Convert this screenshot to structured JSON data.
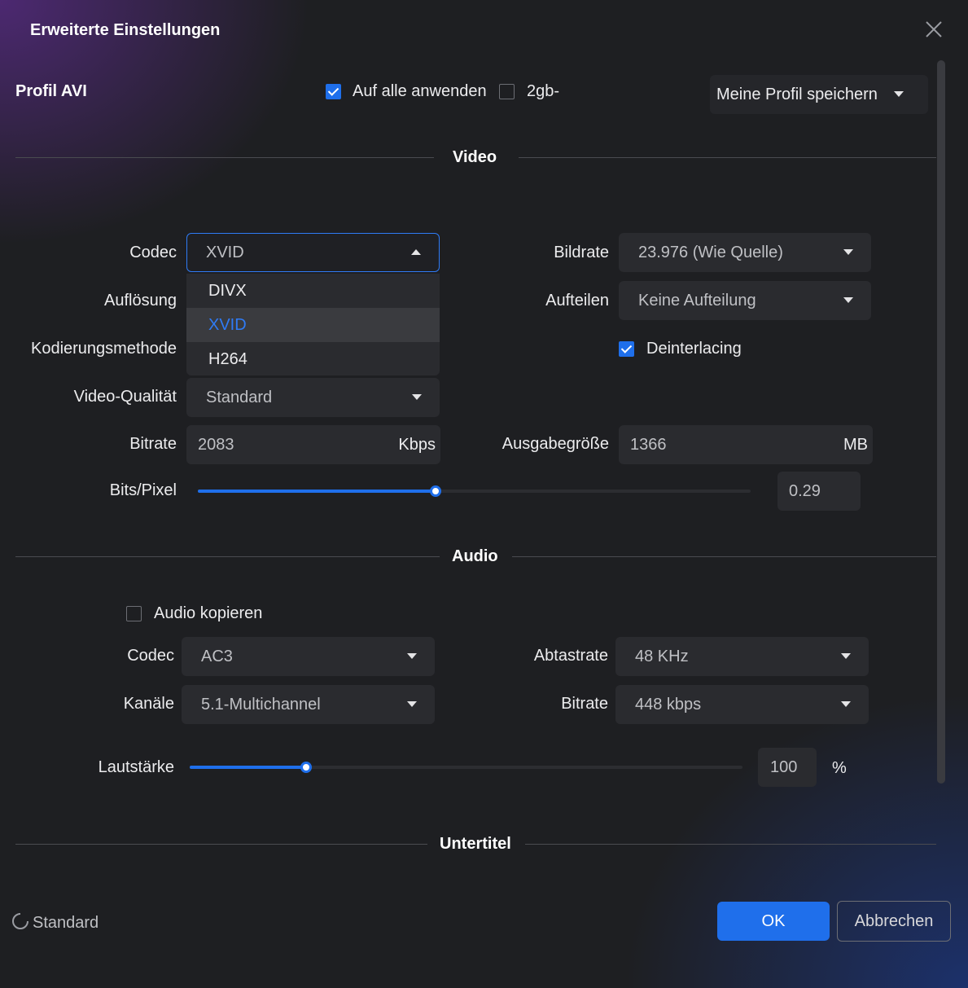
{
  "dialog": {
    "title": "Erweiterte Einstellungen"
  },
  "profile": {
    "label": "Profil  AVI",
    "apply_all": {
      "label": "Auf alle anwenden",
      "checked": true
    },
    "split_2gb": {
      "label": "2gb-",
      "checked": false
    },
    "save_profile": "Meine Profil speichern"
  },
  "video": {
    "section_title": "Video",
    "codec": {
      "label": "Codec",
      "value": "XVID",
      "options": [
        "DIVX",
        "XVID",
        "H264"
      ]
    },
    "resolution": {
      "label": "Auflösung"
    },
    "encoding_method": {
      "label": "Kodierungsmethode"
    },
    "quality": {
      "label": "Video-Qualität",
      "value": "Standard"
    },
    "bitrate": {
      "label": "Bitrate",
      "value": "2083",
      "unit": "Kbps"
    },
    "bits_per_pixel": {
      "label": "Bits/Pixel",
      "value": "0.29",
      "level": 0.43
    },
    "framerate": {
      "label": "Bildrate",
      "value": "23.976 (Wie Quelle)"
    },
    "split": {
      "label": "Aufteilen",
      "value": "Keine Aufteilung"
    },
    "deinterlacing": {
      "label": "Deinterlacing",
      "checked": true
    },
    "output_size": {
      "label": "Ausgabegröße",
      "value": "1366",
      "unit": "MB"
    }
  },
  "audio": {
    "section_title": "Audio",
    "copy_audio": {
      "label": "Audio kopieren",
      "checked": false
    },
    "codec": {
      "label": "Codec",
      "value": "AC3"
    },
    "channels": {
      "label": "Kanäle",
      "value": "5.1-Multichannel"
    },
    "sample_rate": {
      "label": "Abtastrate",
      "value": "48 KHz"
    },
    "bitrate": {
      "label": "Bitrate",
      "value": "448 kbps"
    },
    "volume": {
      "label": "Lautstärke",
      "value": "100",
      "unit": "%",
      "level": 0.21
    }
  },
  "subtitle": {
    "section_title": "Untertitel"
  },
  "footer": {
    "reset_label": "Standard",
    "ok_label": "OK",
    "cancel_label": "Abbrechen"
  },
  "colors": {
    "accent": "#1f6feb",
    "background": "#1e1f22",
    "control": "#2a2b2f"
  }
}
